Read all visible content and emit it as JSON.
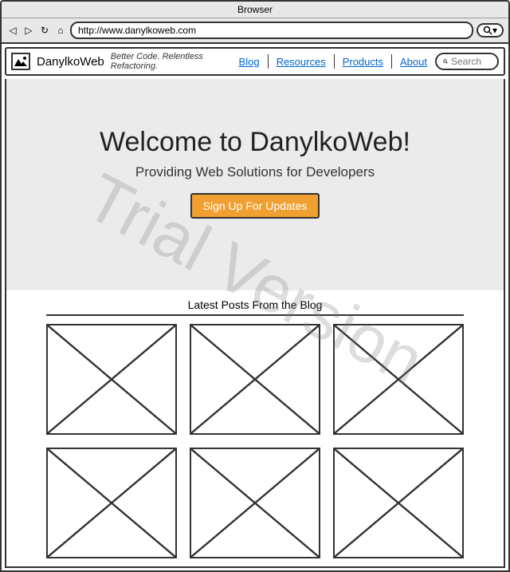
{
  "browser": {
    "title": "Browser",
    "url": "http://www.danylkoweb.com"
  },
  "header": {
    "brand": "DanylkoWeb",
    "tagline": "Better Code. Relentless Refactoring.",
    "nav": {
      "blog": "Blog",
      "resources": "Resources",
      "products": "Products",
      "about": "About"
    },
    "search_placeholder": "Search"
  },
  "hero": {
    "title": "Welcome to DanylkoWeb!",
    "subtitle": "Providing Web Solutions for Developers",
    "cta": "Sign Up For Updates"
  },
  "blog": {
    "heading": "Latest Posts From the Blog"
  },
  "watermark": "Trial Version"
}
